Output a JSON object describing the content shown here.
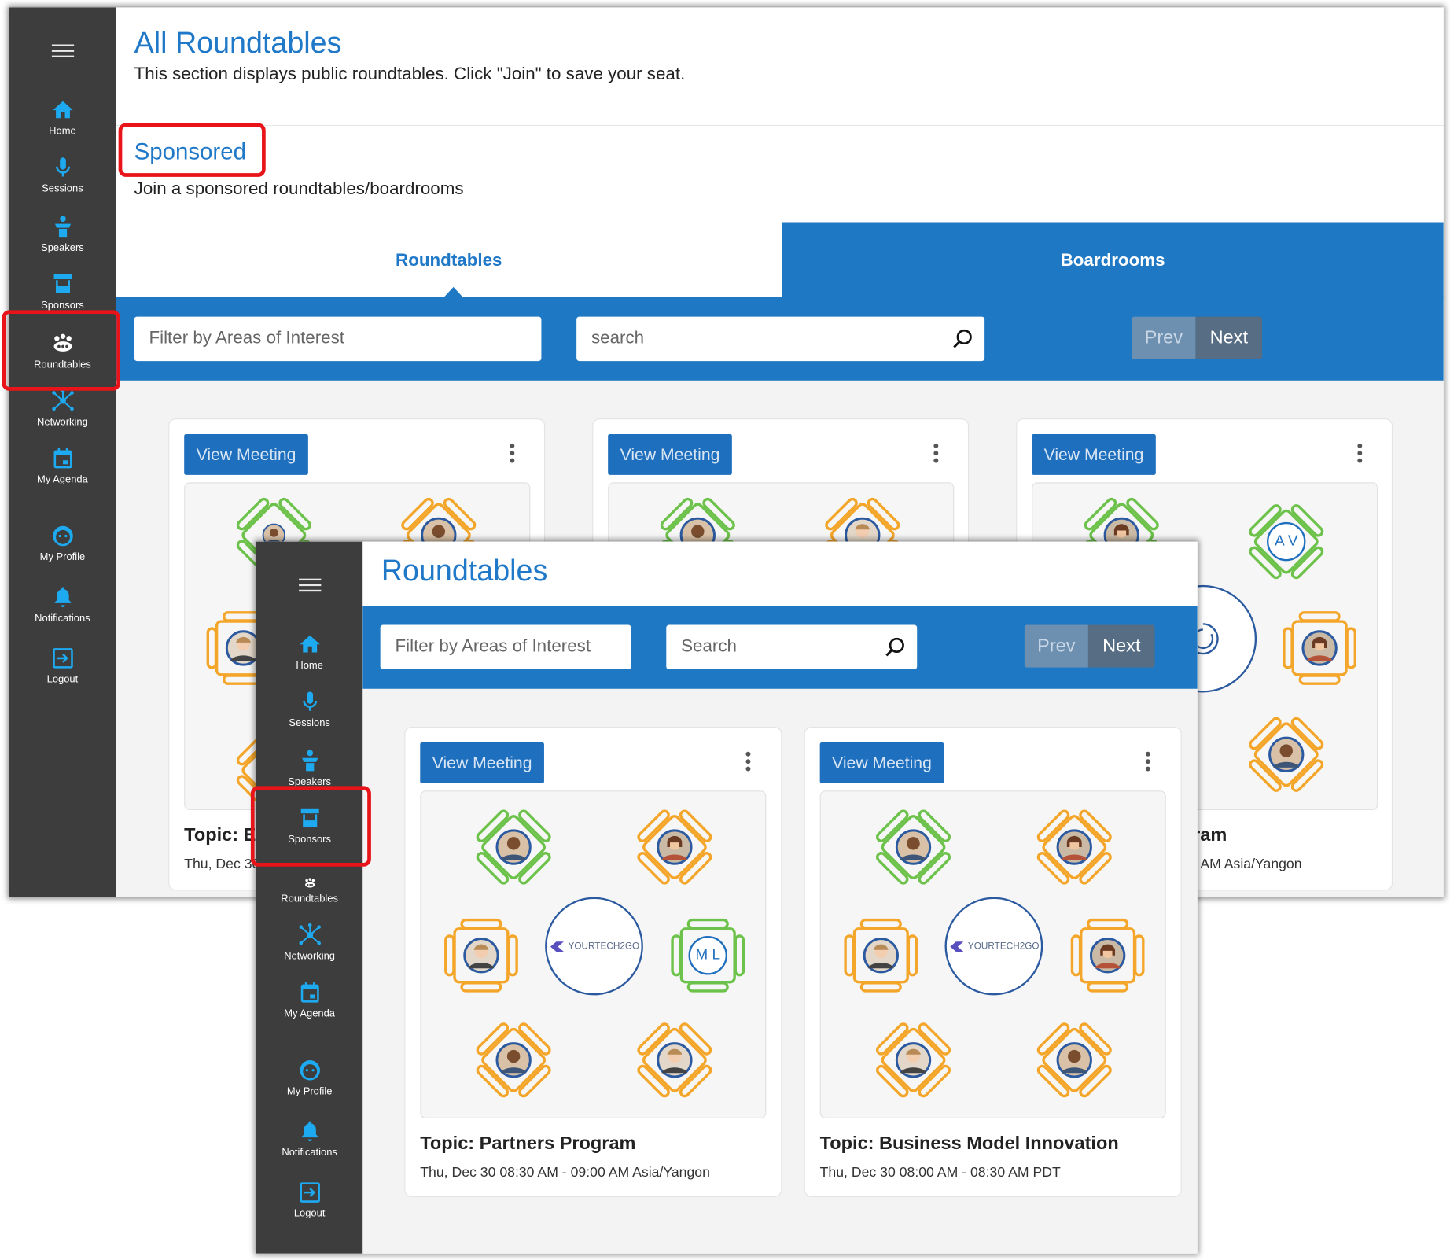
{
  "back": {
    "nav": [
      {
        "label": "Home",
        "icon": "home-icon"
      },
      {
        "label": "Sessions",
        "icon": "microphone-icon"
      },
      {
        "label": "Speakers",
        "icon": "speaker-podium-icon"
      },
      {
        "label": "Sponsors",
        "icon": "sponsor-booth-icon"
      },
      {
        "label": "Roundtables",
        "icon": "roundtable-icon"
      },
      {
        "label": "Networking",
        "icon": "network-icon"
      },
      {
        "label": "My Agenda",
        "icon": "calendar-icon"
      },
      {
        "label": "My Profile",
        "icon": "profile-icon"
      },
      {
        "label": "Notifications",
        "icon": "bell-icon"
      },
      {
        "label": "Logout",
        "icon": "logout-icon"
      }
    ],
    "title": "All Roundtables",
    "description": "This section displays public roundtables. Click \"Join\" to save your seat.",
    "section_title": "Sponsored",
    "section_description": "Join a sponsored roundtables/boardrooms",
    "tabs": [
      "Roundtables",
      "Boardrooms"
    ],
    "filter_placeholder": "Filter by Areas of Interest",
    "search_placeholder": "search",
    "prev": "Prev",
    "next": "Next",
    "view_meeting": "View Meeting",
    "card1": {
      "topic_visible": "Topic: E",
      "date_visible": "Thu, Dec 30"
    },
    "card3": {
      "topic_visible": "gram",
      "date_visible": "30 AM Asia/Yangon",
      "initials": "A V"
    }
  },
  "front": {
    "nav": [
      {
        "label": "Home",
        "icon": "home-icon"
      },
      {
        "label": "Sessions",
        "icon": "microphone-icon"
      },
      {
        "label": "Speakers",
        "icon": "speaker-podium-icon"
      },
      {
        "label": "Sponsors",
        "icon": "sponsor-booth-icon"
      },
      {
        "label": "Roundtables",
        "icon": "roundtable-icon"
      },
      {
        "label": "Networking",
        "icon": "network-icon"
      },
      {
        "label": "My Agenda",
        "icon": "calendar-icon"
      },
      {
        "label": "My Profile",
        "icon": "profile-icon"
      },
      {
        "label": "Notifications",
        "icon": "bell-icon"
      },
      {
        "label": "Logout",
        "icon": "logout-icon"
      }
    ],
    "title": "Roundtables",
    "filter_placeholder": "Filter by Areas of Interest",
    "search_placeholder": "Search",
    "prev": "Prev",
    "next": "Next",
    "view_meeting": "View Meeting",
    "cards": [
      {
        "topic": "Topic: Partners Program",
        "when": "Thu, Dec 30 08:30 AM - 09:00 AM Asia/Yangon",
        "logo": "YOURTECH2GO",
        "initials": "M L"
      },
      {
        "topic": "Topic: Business Model Innovation",
        "when": "Thu, Dec 30 08:00 AM - 08:30 AM PDT",
        "logo": "YOURTECH2GO"
      }
    ]
  },
  "colors": {
    "brand_blue": "#1e78c3",
    "title_blue": "#1f78c8",
    "sidebar": "#3d3d3d",
    "icon_cyan": "#1eaaf1",
    "seat_green": "#6cc24a",
    "seat_orange": "#f4a62a",
    "highlight_red": "#e8141a"
  }
}
